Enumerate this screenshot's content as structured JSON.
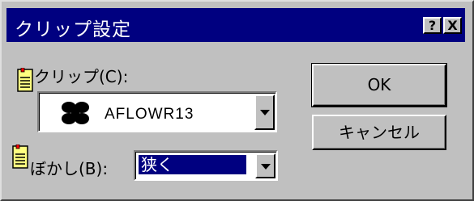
{
  "window": {
    "title": "クリップ設定",
    "help_button": "?",
    "close_button": "X"
  },
  "clip": {
    "label": "クリップ(C):",
    "value": "AFLOWR13",
    "icon": "butterfly-clip-icon"
  },
  "blur": {
    "label": "ぼかし(B):",
    "value": "狭く"
  },
  "buttons": {
    "ok": "OK",
    "cancel": "キャンセル"
  },
  "icons": {
    "help_note": "sticky-note-icon"
  },
  "colors": {
    "titlebar": "#000080",
    "face": "#c0c0c0",
    "selection": "#000080"
  }
}
